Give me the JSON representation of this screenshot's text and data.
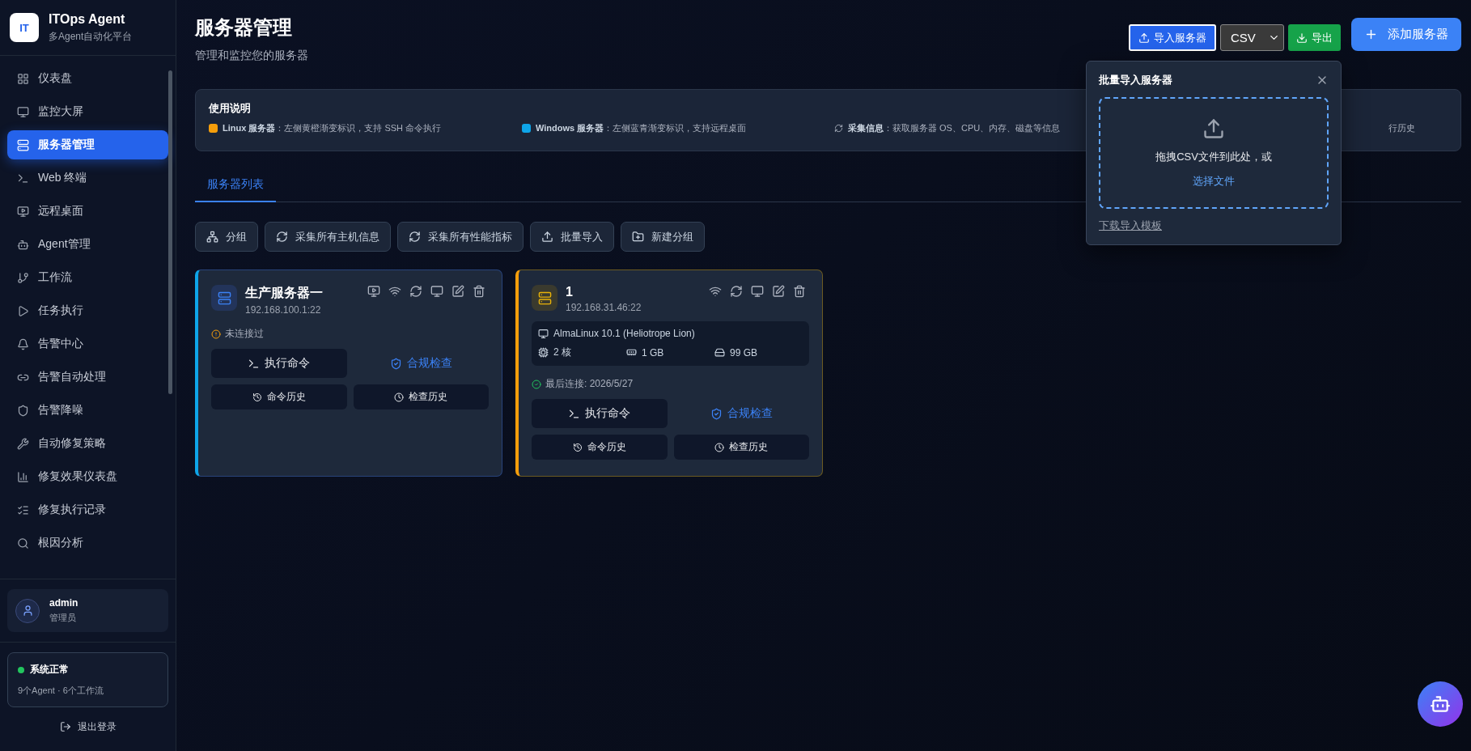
{
  "sidebar": {
    "brand": {
      "logo": "IT",
      "title": "ITOps Agent",
      "subtitle": "多Agent自动化平台"
    },
    "items": [
      {
        "label": "仪表盘",
        "selected": false
      },
      {
        "label": "监控大屏",
        "selected": false
      },
      {
        "label": "服务器管理",
        "selected": true
      },
      {
        "label": "Web 终端",
        "selected": false
      },
      {
        "label": "远程桌面",
        "selected": false
      },
      {
        "label": "Agent管理",
        "selected": false
      },
      {
        "label": "工作流",
        "selected": false
      },
      {
        "label": "任务执行",
        "selected": false
      },
      {
        "label": "告警中心",
        "selected": false
      },
      {
        "label": "告警自动处理",
        "selected": false
      },
      {
        "label": "告警降噪",
        "selected": false
      },
      {
        "label": "自动修复策略",
        "selected": false
      },
      {
        "label": "修复效果仪表盘",
        "selected": false
      },
      {
        "label": "修复执行记录",
        "selected": false
      },
      {
        "label": "根因分析",
        "selected": false
      }
    ],
    "user": {
      "name": "admin",
      "role": "管理员"
    },
    "status": {
      "title": "系统正常",
      "detail": "9个Agent · 6个工作流",
      "color": "#22c55e"
    },
    "logout": "退出登录"
  },
  "header": {
    "title": "服务器管理",
    "subtitle": "管理和监控您的服务器",
    "import_button": "导入服务器",
    "format": "CSV",
    "export_button": "导出",
    "add_button": "添加服务器"
  },
  "guide": {
    "title": "使用说明",
    "items": [
      {
        "kind": "dot",
        "color": "#f59e0b",
        "text": "**Linux 服务器**：左侧黄橙渐变标识，支持 SSH 命令执行"
      },
      {
        "kind": "dot",
        "color": "#0ea5e9",
        "text": "**Windows 服务器**：左侧蓝青渐变标识，支持远程桌面"
      },
      {
        "kind": "refresh",
        "text": "**采集信息**：获取服务器 OS、CPU、内存、磁盘等信息"
      },
      {
        "kind": "plain",
        "text": "行历史"
      }
    ]
  },
  "tabs": [
    {
      "label": "服务器列表",
      "selected": true
    }
  ],
  "toolbar": [
    "分组",
    "采集所有主机信息",
    "采集所有性能指标",
    "批量导入",
    "新建分组"
  ],
  "servers": [
    {
      "kind": "windows",
      "name": "生产服务器一",
      "address": "192.168.100.1:22",
      "status": {
        "kind": "never",
        "text": "未连接过"
      },
      "actions": {
        "execute": "执行命令",
        "compliance": "合规检查",
        "command_history": "命令历史",
        "check_history": "检查历史"
      }
    },
    {
      "kind": "linux",
      "name": "1",
      "address": "192.168.31.46:22",
      "info": {
        "os": "AlmaLinux 10.1 (Heliotrope Lion)",
        "cpu": "2 核",
        "memory": "1 GB",
        "disk": "99 GB"
      },
      "status": {
        "kind": "connected",
        "text": "最后连接: 2026/5/27"
      },
      "actions": {
        "execute": "执行命令",
        "compliance": "合规检查",
        "command_history": "命令历史",
        "check_history": "检查历史"
      }
    }
  ],
  "import_popover": {
    "title": "批量导入服务器",
    "drop_text": "拖拽CSV文件到此处，或",
    "choose_link": "选择文件",
    "template_link": "下载导入模板"
  }
}
